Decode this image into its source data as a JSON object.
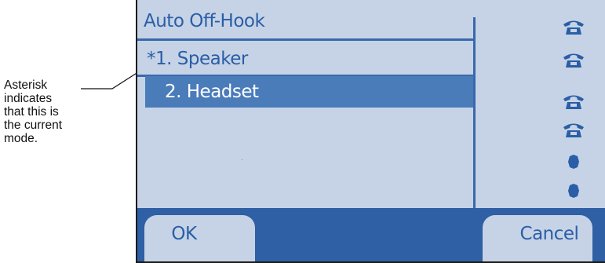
{
  "callout": {
    "lines": [
      "Asterisk",
      "indicates",
      "that this is",
      "the current",
      "mode."
    ]
  },
  "screen": {
    "title": "Auto Off-Hook",
    "menu": [
      {
        "label": "*1. Speaker",
        "selected": false
      },
      {
        "label": "2. Headset",
        "selected": true
      }
    ],
    "line_icons": [
      "phone-icon",
      "phone-icon",
      "phone-icon",
      "phone-icon",
      "dot-icon",
      "dot-icon"
    ]
  },
  "softkeys": {
    "ok_label": "OK",
    "cancel_label": "Cancel"
  },
  "colors": {
    "screen_bg": "#c6d3e6",
    "accent": "#2a5ea6",
    "selection": "#4a7cba",
    "softkey_bar": "#2f5fa4"
  }
}
